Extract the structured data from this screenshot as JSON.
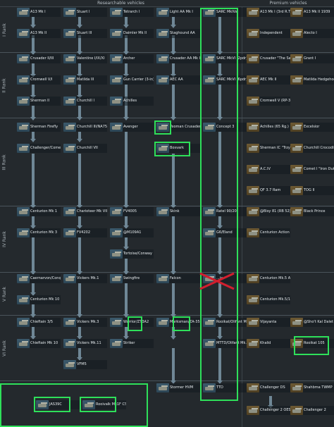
{
  "headers": {
    "researchable": "Researchable vehicles",
    "premium": "Premium vehicles"
  },
  "ranks": [
    "I Rank",
    "II Rank",
    "III Rank",
    "IV Rank",
    "V Rank",
    "VI Rank"
  ],
  "colors": {
    "highlight": "#2ee05a",
    "arrow": "#6f8796",
    "strike": "#d21f2e"
  },
  "vehicles": {
    "a13_mk1": "A13 Mk I",
    "stuart1": "Stuart I",
    "tetrarch1": "Tetrarch I",
    "light_aa_mk1": "Light AA Mk I",
    "sarc_mkiva": "SARC MkIVa",
    "a13_mk2": "A13 Mk II",
    "stuart3": "Stuart III",
    "daimler_mk2": "Daimler Mk II",
    "staghound_aa": "Staghound AA",
    "crusader23": "Crusader II/III",
    "valentine": "Valentine I/IX/XI",
    "archer": "Archer",
    "crusader_aa_mk1": "Crusader AA Mk I",
    "sarc_mkvi_2pdr": "SARC MkVI (2pdr)",
    "cromwell_vi": "Cromwell V/I",
    "matilda3": "Matilda III",
    "gun_carrier": "Gun Carrier (3-in)",
    "aec_aa": "AEC AA",
    "sarc_mkvi_6pdr": "SARC MkVI (6pdr)",
    "sherman2": "Sherman II",
    "churchill1": "Churchill I",
    "achilles": "Achilles",
    "sherman_firefly": "Sherman Firefly",
    "churchill_375": "Churchill III/NA75",
    "avenger": "Avenger",
    "yeoman_crusader": "Yeoman Crusader",
    "concept3": "Concept 3",
    "challenger_comet": "Challenger/Comet",
    "churchill7": "Churchill VII",
    "bosvark": "Bosvark",
    "centurion_mk1": "Centurion Mk 1",
    "charioteer": "Charioteer Mk VII",
    "fv4005": "FV4005",
    "skink": "Skink",
    "ratel_9020": "Ratel 90/20",
    "centurion_mk3": "Centurion Mk 3",
    "fv4202": "FV4202",
    "m109a1": "@M109A1",
    "g6_eland": "G6/Eland",
    "tortoise_conway": "Tortoise/Conway",
    "caernarvon_conq": "Caernarvon/Conq.",
    "vickers_mk1": "Vickers Mk.1",
    "swingfire": "Swingfire",
    "falcon": "Falcon",
    "struck_vehicle": "...ia",
    "centurion_mk10": "Centurion Mk 10",
    "chieftain_35": "Chieftain 3/5",
    "vickers_mk3": "Vickers Mk.3",
    "warrior_zt3a2": "Warrior/ZT3A2",
    "marksman_za35": "Marksman/ZA-35",
    "rooikat_olifant_mk": "Rooikat/Olifant Mk",
    "chieftain_mk10": "Chieftain Mk 10",
    "vickers_mk11": "Vickers Mk.11",
    "striker": "Striker",
    "mtt_olifant_mk2": "MTTD/Olifant Mk.2",
    "vfm5": "VFM5",
    "stormer_hvm": "Stormer HVM",
    "ttd": "TTD",
    "jas39c": "JAS39C",
    "rooivalk": "Rooivalk Mk1F CSI"
  },
  "premium": {
    "a13_mk1_3rt": "A13 Mk I (3rd R.T.",
    "a13_mk2_1939": "A13 Mk II 1939",
    "independent": "Independent",
    "alecto": "Alecto I",
    "crusader_the_sai": "Crusader \"The Sai",
    "grant1": "Grant I",
    "aec_mk2": "AEC Mk II",
    "matilda_hedgehog": "Matilda Hedgehog",
    "cromwell_rp3": "Cromwell V (RP-3",
    "achilles_65rg": "Achilles (65 Rg.)",
    "excelsior": "Excelsior",
    "sherman_ic_trzye": "Sherman IC \"Trzye",
    "churchill_crocodile": "Churchill Crocodile",
    "aciv": "A.C.IV",
    "comet_iron_duke": "Comet I \"Iron Duke",
    "qf37ram": "QF 3.7 Ram",
    "tog2": "TOG II",
    "bishop81": "@Bisy 81 (RB 52)",
    "black_prince": "Black Prince",
    "centurion_action_x": "Centurion Action X",
    "centurion_mk5_av": "Centurion Mk.5 AV",
    "centurion_mk51": "Centurion Mk.5/1",
    "vijayanta": "Vijayanta",
    "shot_kal_dalet": "@Sho't Kal Dalet",
    "khalid": "Khalid",
    "rooikat_105": "Rooikat 105",
    "challenger_ds": "Challenger DS",
    "shahbma_twmp": "Shahbma TWMP",
    "challenger_2_oes": "Challenger 2 OES",
    "challenger_2_star": "Challenger 2"
  }
}
